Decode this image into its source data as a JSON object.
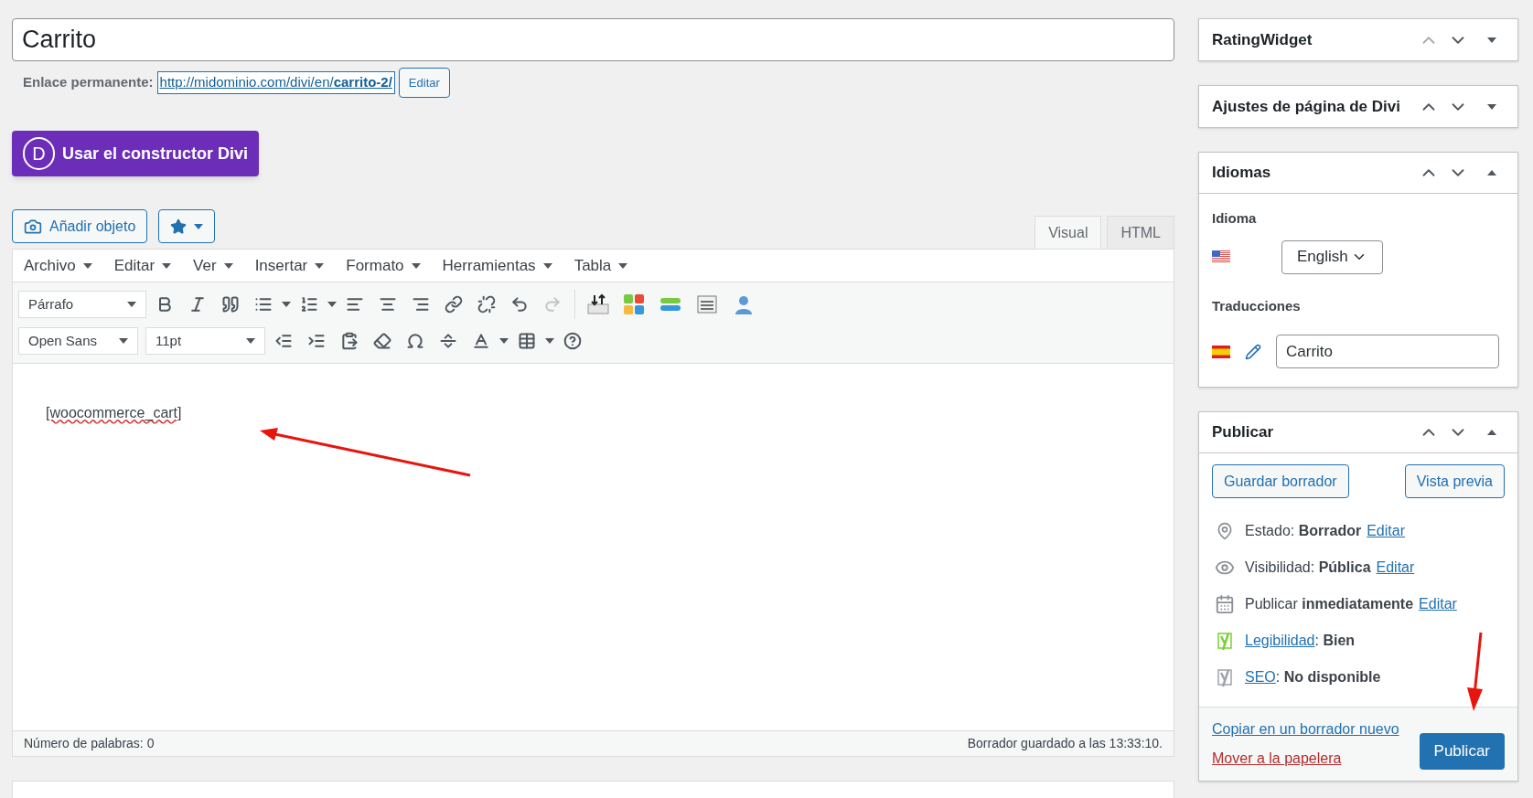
{
  "title_field": {
    "value": "Carrito"
  },
  "permalink": {
    "label": "Enlace permanente:",
    "url_base": "http://midominio.com/divi/en/",
    "url_slug": "carrito-2/",
    "edit_button": "Editar"
  },
  "divi_button": {
    "letter": "D",
    "label": "Usar el constructor Divi"
  },
  "media_button": "Añadir objeto",
  "editor_tabs": [
    {
      "label": "Visual",
      "selected": true
    },
    {
      "label": "HTML",
      "selected": false
    }
  ],
  "menu": [
    "Archivo",
    "Editar",
    "Ver",
    "Insertar",
    "Formato",
    "Herramientas",
    "Tabla"
  ],
  "toolbar": {
    "format": "Párrafo",
    "font": "Open Sans",
    "size": "11pt",
    "redo_enabled": false
  },
  "content": {
    "text": "[woocommerce_cart]",
    "misspelled": true
  },
  "status_bar": {
    "word_count": "Número de palabras: 0",
    "saved": "Borrador guardado a las 13:33:10."
  },
  "sidebar": [
    {
      "title": "RatingWidget",
      "expanded": false,
      "up_enabled": false,
      "kind": "empty"
    },
    {
      "title": "Ajustes de página de Divi",
      "expanded": false,
      "up_enabled": true,
      "kind": "empty"
    },
    {
      "title": "Idiomas",
      "expanded": true,
      "up_enabled": true,
      "kind": "languages"
    },
    {
      "title": "Publicar",
      "expanded": true,
      "up_enabled": true,
      "kind": "publish"
    }
  ],
  "languages": {
    "language_label": "Idioma",
    "language": "English",
    "translations_label": "Traducciones",
    "translation": "Carrito"
  },
  "publish": {
    "save_draft": "Guardar borrador",
    "preview": "Vista previa",
    "rows": [
      {
        "kind": "status",
        "text": "Estado: **Borrador**",
        "link": "Editar"
      },
      {
        "kind": "visibility",
        "text": "Visibilidad: **Pública**",
        "link": "Editar"
      },
      {
        "kind": "schedule",
        "text": "Publicar **inmediatamente**",
        "link": "Editar"
      },
      {
        "kind": "readability",
        "link": "Legibilidad",
        "text": ": **Bien**",
        "color": "#7ad03a"
      },
      {
        "kind": "seo",
        "link": "SEO",
        "text": ": **No disponible**",
        "color": "#a0a5aa"
      }
    ],
    "copy_link": "Copiar en un borrador nuevo",
    "trash_link": "Mover a la papelera",
    "publish_button": "Publicar"
  }
}
